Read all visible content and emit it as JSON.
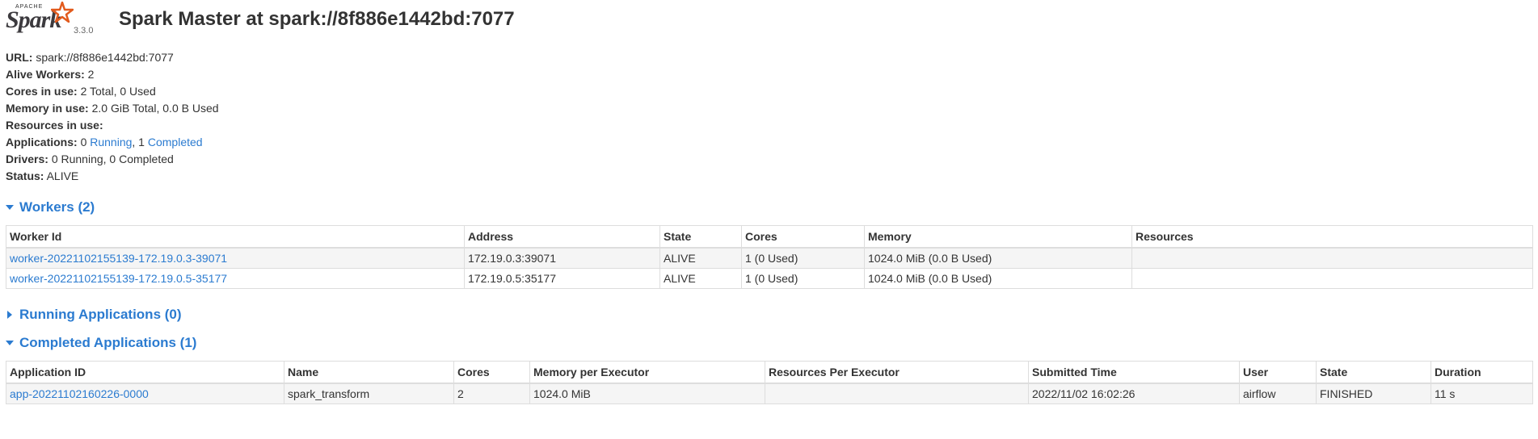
{
  "header": {
    "logo_apache": "APACHE",
    "logo_word": "Spark",
    "version": "3.3.0",
    "title": "Spark Master at spark://8f886e1442bd:7077"
  },
  "info": {
    "url_label": "URL:",
    "url_value": "spark://8f886e1442bd:7077",
    "alive_workers_label": "Alive Workers:",
    "alive_workers_value": "2",
    "cores_label": "Cores in use:",
    "cores_value": "2 Total, 0 Used",
    "memory_label": "Memory in use:",
    "memory_value": "2.0 GiB Total, 0.0 B Used",
    "resources_label": "Resources in use:",
    "applications_label": "Applications:",
    "applications_running_count": "0",
    "applications_running_link": "Running",
    "applications_separator": ", 1",
    "applications_completed_link": "Completed",
    "drivers_label": "Drivers:",
    "drivers_value": "0 Running, 0 Completed",
    "status_label": "Status:",
    "status_value": "ALIVE"
  },
  "workers": {
    "heading": "Workers (2)",
    "columns": [
      "Worker Id",
      "Address",
      "State",
      "Cores",
      "Memory",
      "Resources"
    ],
    "rows": [
      [
        "worker-20221102155139-172.19.0.3-39071",
        "172.19.0.3:39071",
        "ALIVE",
        "1 (0 Used)",
        "1024.0 MiB (0.0 B Used)",
        ""
      ],
      [
        "worker-20221102155139-172.19.0.5-35177",
        "172.19.0.5:35177",
        "ALIVE",
        "1 (0 Used)",
        "1024.0 MiB (0.0 B Used)",
        ""
      ]
    ]
  },
  "running_apps": {
    "heading": "Running Applications (0)"
  },
  "completed_apps": {
    "heading": "Completed Applications (1)",
    "columns": [
      "Application ID",
      "Name",
      "Cores",
      "Memory per Executor",
      "Resources Per Executor",
      "Submitted Time",
      "User",
      "State",
      "Duration"
    ],
    "rows": [
      [
        "app-20221102160226-0000",
        "spark_transform",
        "2",
        "1024.0 MiB",
        "",
        "2022/11/02 16:02:26",
        "airflow",
        "FINISHED",
        "11 s"
      ]
    ]
  },
  "colors": {
    "link": "#2b7bd0",
    "logo_star": "#e25a1c"
  }
}
